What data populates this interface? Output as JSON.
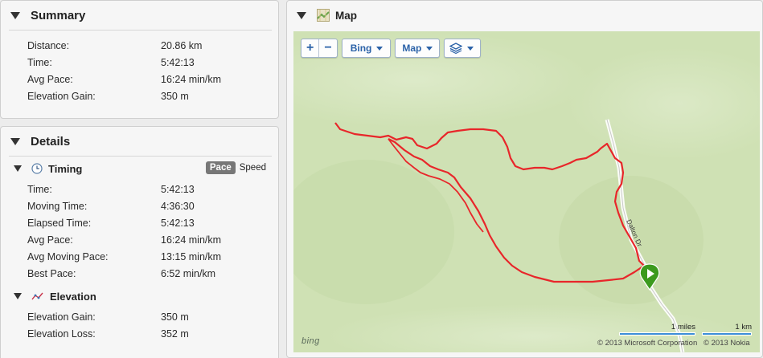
{
  "summary": {
    "title": "Summary",
    "rows": [
      {
        "label": "Distance:",
        "value": "20.86 km"
      },
      {
        "label": "Time:",
        "value": "5:42:13"
      },
      {
        "label": "Avg Pace:",
        "value": "16:24 min/km"
      },
      {
        "label": "Elevation Gain:",
        "value": "350 m"
      }
    ]
  },
  "details": {
    "title": "Details",
    "timing": {
      "title": "Timing",
      "toggle": {
        "pace": "Pace",
        "speed": "Speed",
        "selected": "Pace"
      },
      "rows": [
        {
          "label": "Time:",
          "value": "5:42:13"
        },
        {
          "label": "Moving Time:",
          "value": "4:36:30"
        },
        {
          "label": "Elapsed Time:",
          "value": "5:42:13"
        },
        {
          "label": "Avg Pace:",
          "value": "16:24 min/km"
        },
        {
          "label": "Avg Moving Pace:",
          "value": "13:15 min/km"
        },
        {
          "label": "Best Pace:",
          "value": "6:52 min/km"
        }
      ]
    },
    "elevation": {
      "title": "Elevation",
      "rows": [
        {
          "label": "Elevation Gain:",
          "value": "350 m"
        },
        {
          "label": "Elevation Loss:",
          "value": "352 m"
        }
      ]
    }
  },
  "map": {
    "title": "Map",
    "zoom_in": "+",
    "zoom_out": "−",
    "provider": "Bing",
    "map_type": "Map",
    "road_label": "Dalton Dr",
    "logo": "bing",
    "copyright_ms": "© 2013 Microsoft Corporation",
    "copyright_nokia": "© 2013 Nokia",
    "scale_miles": "1 miles",
    "scale_km": "1 km",
    "route_color": "#e8262a",
    "marker_color": "#3c9a1e"
  }
}
